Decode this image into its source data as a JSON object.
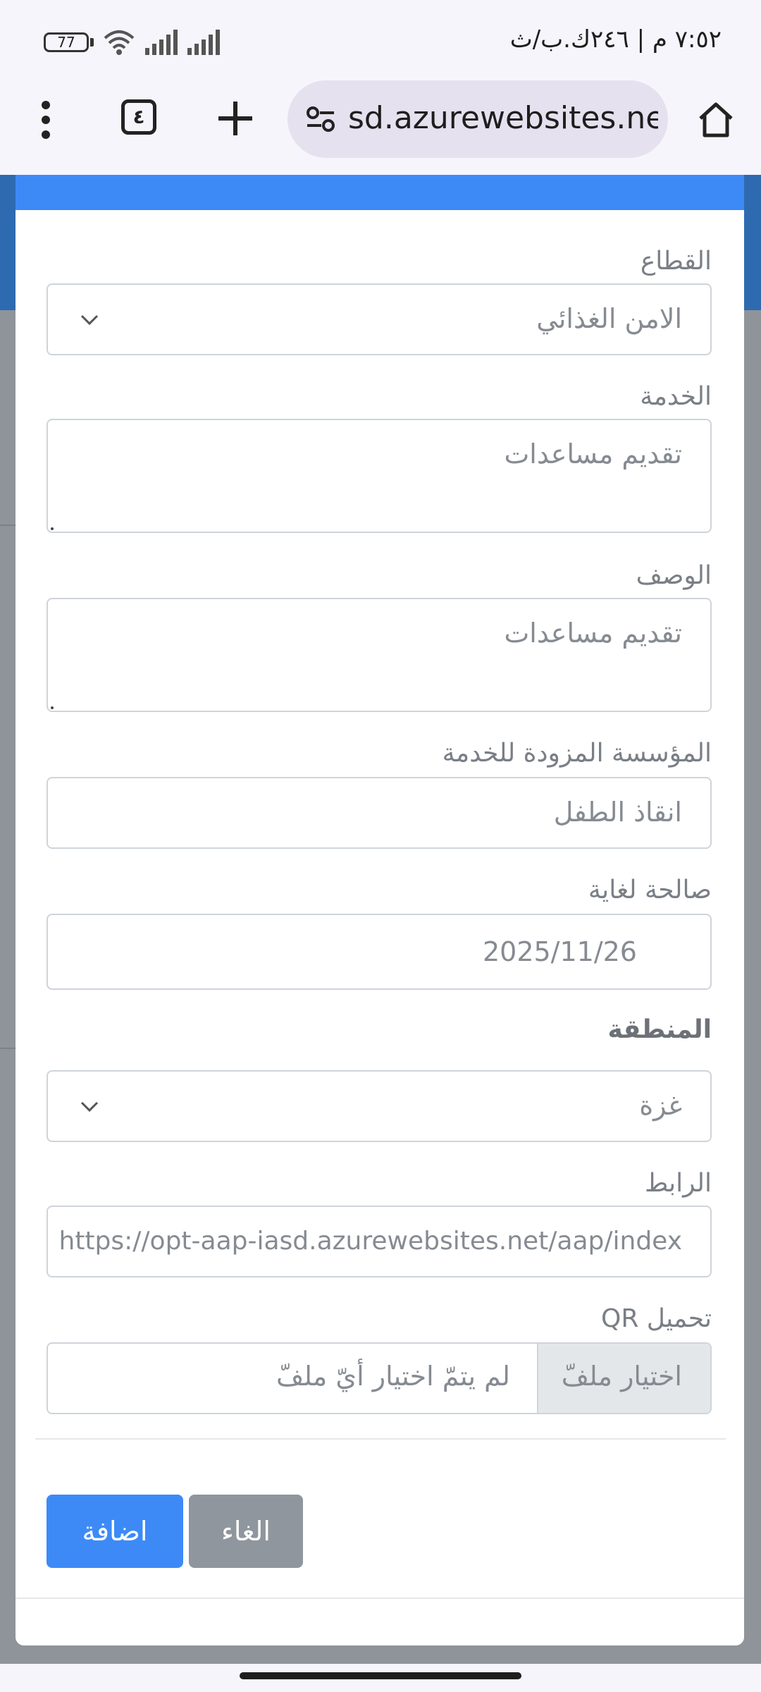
{
  "status_bar": {
    "battery_level": "77",
    "time": "٧:٥٢ م | ٢٤٦ك.ب/ث"
  },
  "browser": {
    "url": "sd.azurewebsites.net",
    "tab_count": "٤"
  },
  "form": {
    "sector": {
      "label": "القطاع",
      "value": "الامن الغذائي"
    },
    "service": {
      "label": "الخدمة",
      "value": "تقديم مساعدات"
    },
    "description": {
      "label": "الوصف",
      "value": "تقديم مساعدات"
    },
    "provider": {
      "label": "المؤسسة المزودة للخدمة",
      "value": "انقاذ الطفل"
    },
    "valid_until": {
      "label": "صالحة لغاية",
      "value": "2025/11/26"
    },
    "region": {
      "label": "المنطقة",
      "value": "غزة"
    },
    "link": {
      "label": "الرابط",
      "value": "https://opt-aap-iasd.azurewebsites.net/aap/index"
    },
    "qr_upload": {
      "label": "تحميل QR",
      "button": "اختيار ملفّ",
      "status": "لم يتمّ اختيار أيّ ملفّ"
    }
  },
  "actions": {
    "add": "اضافة",
    "cancel": "الغاء"
  },
  "colors": {
    "primary": "#3d8af7",
    "secondary": "#8f969d",
    "overlay": "#8f949a"
  }
}
